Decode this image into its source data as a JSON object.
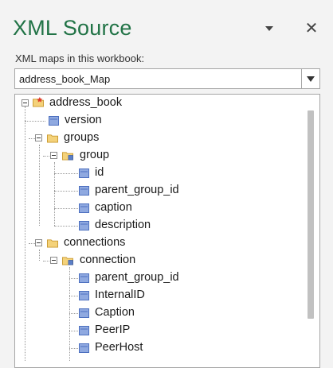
{
  "pane": {
    "title": "XML Source",
    "menu_icon": "dropdown-triangle",
    "close_icon": "close-x"
  },
  "maps": {
    "label": "XML maps in this workbook:",
    "selected": "address_book_Map"
  },
  "tree": {
    "root": "address_book",
    "version": "version",
    "groups": "groups",
    "group": "group",
    "id": "id",
    "group_parent_group_id": "parent_group_id",
    "caption": "caption",
    "description": "description",
    "connections": "connections",
    "connection": "connection",
    "conn_parent_group_id": "parent_group_id",
    "internal_id": "InternalID",
    "conn_caption": "Caption",
    "peer_ip": "PeerIP",
    "peer_host": "PeerHost"
  },
  "colors": {
    "title_green": "#217346",
    "folder_yellow": "#e8b84a",
    "leaf_blue": "#5b7fc7"
  }
}
